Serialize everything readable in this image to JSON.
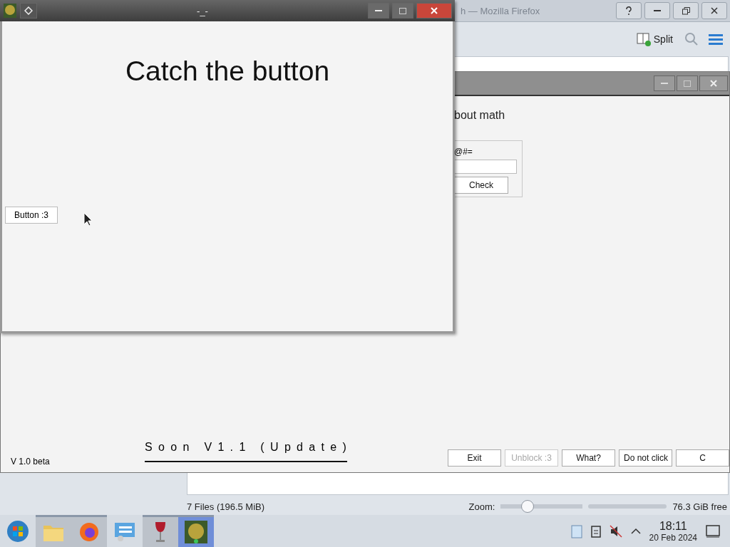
{
  "file_manager": {
    "title_fragment": "h — Mozilla Firefox",
    "toolbar": {
      "split": "Split"
    },
    "status_bar": {
      "files": "7 Files (196.5 MiB)",
      "zoom_label": "Zoom:",
      "zoom": {
        "level": 0.29
      },
      "free": "76.3 GiB free"
    }
  },
  "math_window": {
    "heading": "bout math",
    "group_label": "@#=",
    "check": "Check",
    "version": "V 1.0 beta",
    "banner": "Soon V1.1 (Update)",
    "buttons": [
      {
        "label": "Exit",
        "disabled": false
      },
      {
        "label": "Unblock :3",
        "disabled": true
      },
      {
        "label": "What?",
        "disabled": false
      },
      {
        "label": "Do not click",
        "disabled": false
      },
      {
        "label": "C",
        "disabled": false
      }
    ]
  },
  "front_window": {
    "title": "-_-",
    "heading": "Catch the button",
    "button": "Button :3"
  },
  "taskbar": {
    "apps": [
      {
        "kind": "folder",
        "running": true,
        "selected": false
      },
      {
        "kind": "firefox",
        "running": true,
        "selected": false
      },
      {
        "kind": "monitor",
        "running": false,
        "selected": false
      },
      {
        "kind": "wine",
        "running": true,
        "selected": false
      },
      {
        "kind": "game",
        "running": true,
        "selected": true
      }
    ],
    "clock": {
      "time": "18:11",
      "date": "20 Feb 2024"
    }
  }
}
